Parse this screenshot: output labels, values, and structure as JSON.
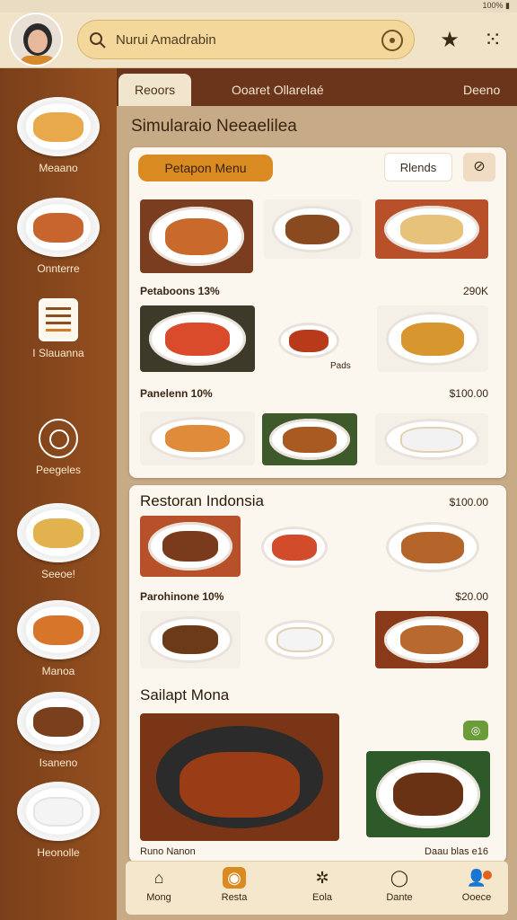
{
  "status": {
    "right_text": "100% ▮"
  },
  "search": {
    "text": "Nurui Amadrabin"
  },
  "tabs": [
    {
      "label": "Reoors"
    },
    {
      "label": "Ooaret Ollarelaé"
    },
    {
      "label": "Deeno"
    }
  ],
  "page_title": "Simularaio Neeaelilea",
  "sidebar": {
    "items": [
      {
        "label": "Meaano",
        "color": "#e8a94a"
      },
      {
        "label": "Onnterre",
        "color": "#c8652e"
      },
      {
        "label": "I Slauanna"
      },
      {
        "label": "Peegeles"
      },
      {
        "label": "Seeoe!",
        "color": "#e2b24e"
      },
      {
        "label": "Manoa",
        "color": "#d7762b"
      },
      {
        "label": "Isaneno",
        "color": "#7a3f1c"
      },
      {
        "label": "Heonolle",
        "color": "#ffffff"
      }
    ]
  },
  "card1": {
    "primary": "Petapon Menu",
    "ghost": "Rlends",
    "rows": [
      {
        "left": "Petaboons 13%",
        "right": "290K"
      },
      {
        "left": "Panelenn 10%",
        "right": "$100.00"
      }
    ],
    "mid_caption": "Pads",
    "thumbs": [
      {
        "color": "#c9692c"
      },
      {
        "color": "#8a4a20"
      },
      {
        "color": "#e6c27a"
      },
      {
        "color": "#d94b2a"
      },
      {
        "color": "#b83a1b"
      },
      {
        "color": "#d7962e"
      },
      {
        "color": "#e08b3a"
      },
      {
        "color": "#a95a22"
      },
      {
        "color": "#f2f2f2"
      }
    ]
  },
  "card2": {
    "title": "Restoran Indonsia",
    "title_right": "$100.00",
    "rows": [
      {
        "left": "Parohinone 10%",
        "right": "$20.00"
      }
    ],
    "section": "Sailapt Mona",
    "bottom_left": "Runo Nanon",
    "bottom_right": "Daau blas e16",
    "thumbs": [
      {
        "color": "#7a3a1c"
      },
      {
        "color": "#d24b2a"
      },
      {
        "color": "#b5642a"
      },
      {
        "color": "#6b3a18"
      },
      {
        "color": "#f4f4f4"
      },
      {
        "color": "#b86a2e"
      },
      {
        "color": "#9a3d16"
      },
      {
        "color": "#6a3215"
      }
    ]
  },
  "bottomnav": [
    {
      "label": "Mong",
      "icon": "home-icon"
    },
    {
      "label": "Resta",
      "icon": "dish-icon"
    },
    {
      "label": "Eola",
      "icon": "gear-icon"
    },
    {
      "label": "Dante",
      "icon": "leaf-icon"
    },
    {
      "label": "Ooece",
      "icon": "user-icon"
    }
  ]
}
